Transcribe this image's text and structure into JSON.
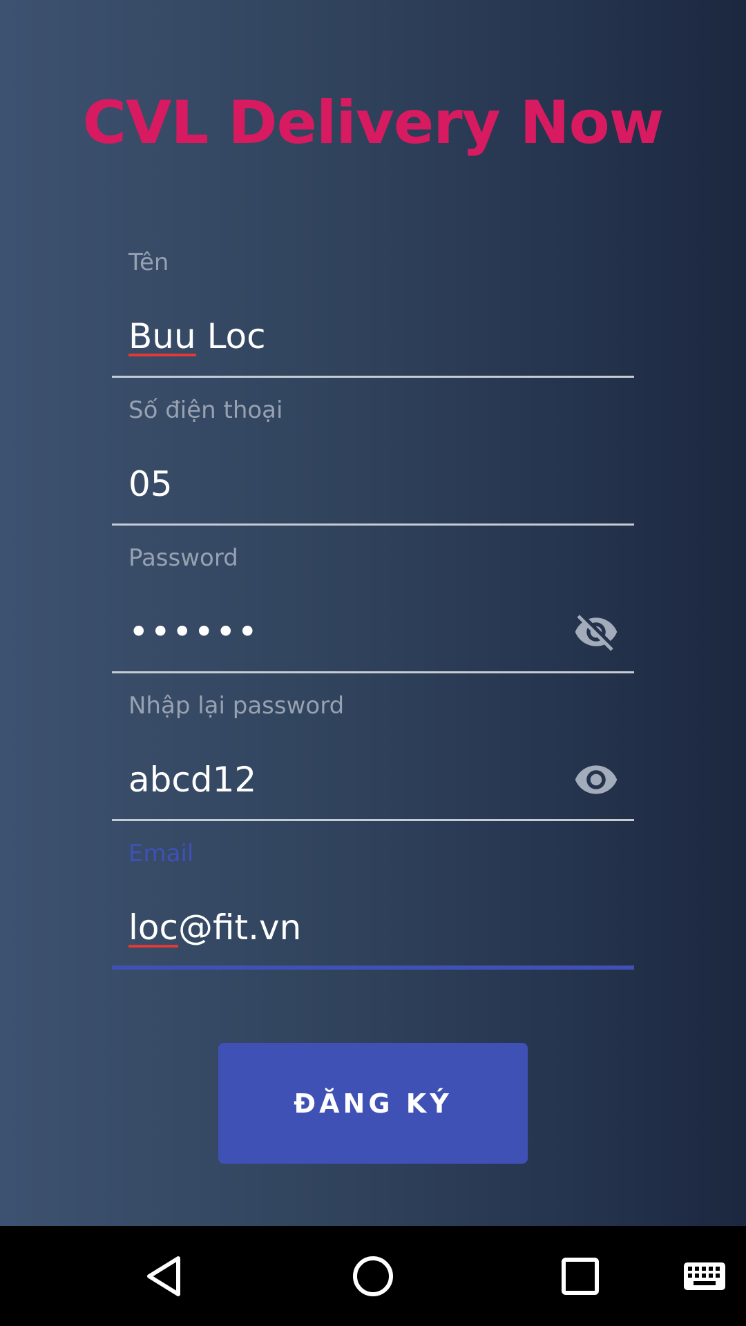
{
  "app": {
    "title": "CVL Delivery Now"
  },
  "form": {
    "name": {
      "label": "Tên",
      "value": "Buu Loc",
      "spellcheck_word": "Buu",
      "rest": " Loc"
    },
    "phone": {
      "label": "Số điện thoại",
      "value": "05"
    },
    "password": {
      "label": "Password",
      "value": "••••••",
      "icon": "visibility-off-icon"
    },
    "confirm_password": {
      "label": "Nhập lại password",
      "value": "abcd12",
      "icon": "visibility-icon"
    },
    "email": {
      "label": "Email",
      "value": "loc@fit.vn",
      "spellcheck_word": "loc",
      "rest": "@fit.vn",
      "focused": true
    }
  },
  "register_button": {
    "label": "ĐĂNG KÝ"
  },
  "navbar": {
    "items": [
      "back-icon",
      "home-icon",
      "recents-icon",
      "keyboard-icon"
    ]
  },
  "colors": {
    "title": "#d81b60",
    "accent": "#3f51b5",
    "label": "#97a1b1",
    "spell_error": "#e53935"
  }
}
